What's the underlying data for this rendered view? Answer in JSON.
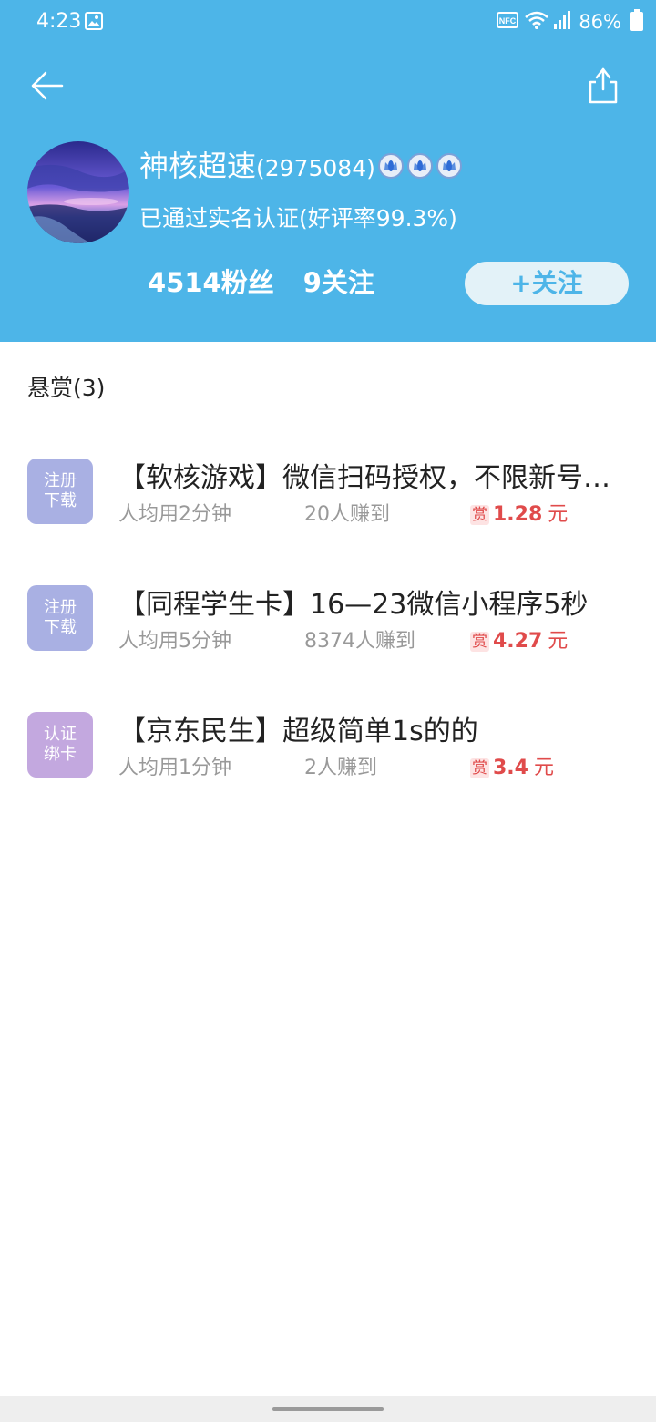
{
  "status_bar": {
    "time": "4:23",
    "battery": "86%",
    "icons": [
      "gallery-icon",
      "nfc-icon",
      "wifi-icon",
      "signal-icon",
      "battery-icon"
    ]
  },
  "header": {
    "back_icon": "arrow-left-icon",
    "share_icon": "share-icon",
    "background_color": "#4db5e8"
  },
  "profile": {
    "name": "神核超速",
    "id": "(2975084)",
    "verified_text": "已通过实名认证(好评率99.3%)",
    "followers_count": "4514",
    "followers_label": "粉丝",
    "following_count": "9",
    "following_label": "关注",
    "follow_button_label": "+关注",
    "crown_count": 3
  },
  "section": {
    "title": "悬赏(3)"
  },
  "tasks": [
    {
      "badge_line1": "注册",
      "badge_line2": "下载",
      "badge_color": "#a9b0e3",
      "title": "【软核游戏】微信扫码授权，不限新号老号",
      "avg_time": "人均用2分钟",
      "earned_count": "20人赚到",
      "reward_tag": "赏",
      "reward_amount": "1.28",
      "reward_unit": "元"
    },
    {
      "badge_line1": "注册",
      "badge_line2": "下载",
      "badge_color": "#a9b0e3",
      "title": "【同程学生卡】16—23微信小程序5秒",
      "avg_time": "人均用5分钟",
      "earned_count": "8374人赚到",
      "reward_tag": "赏",
      "reward_amount": "4.27",
      "reward_unit": "元"
    },
    {
      "badge_line1": "认证",
      "badge_line2": "绑卡",
      "badge_color": "#c3a8df",
      "title": "【京东民生】超级简单1s的的",
      "avg_time": "人均用1分钟",
      "earned_count": "2人赚到",
      "reward_tag": "赏",
      "reward_amount": "3.4",
      "reward_unit": "元"
    }
  ],
  "colors": {
    "accent": "#4db5e8",
    "reward": "#e04b4b",
    "muted_text": "#999999"
  }
}
